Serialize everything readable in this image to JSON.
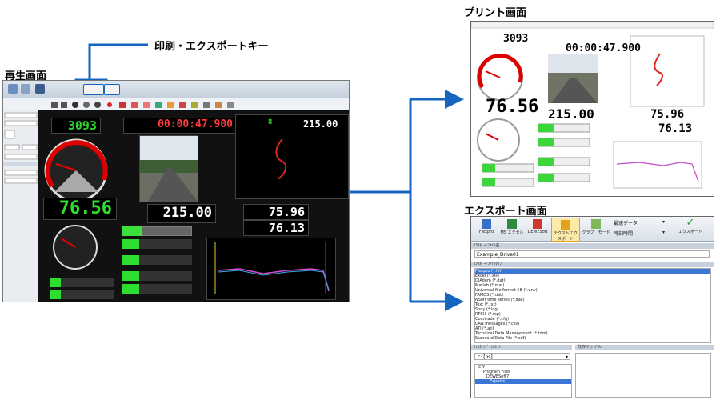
{
  "labels": {
    "playback_screen": "再生画面",
    "print_export_key": "印刷・エクスポートキー",
    "print_screen": "プリント画面",
    "export_screen": "エクスポート画面"
  },
  "playback": {
    "counter": "3093",
    "timer": "00:00:47.900",
    "speed": "76.56",
    "distance": "215.00",
    "value_a": "75.96",
    "value_b": "76.13",
    "small_left": "8",
    "small_right": "215.00"
  },
  "print": {
    "counter": "3093",
    "timer": "00:00:47.900",
    "speed": "76.56",
    "distance": "215.00",
    "value_a": "75.96",
    "value_b": "76.13"
  },
  "export": {
    "ribbon": [
      {
        "label": "Flexpro",
        "color": "#3a6fc7"
      },
      {
        "label": "MS エクセル",
        "color": "#2e8b3d"
      },
      {
        "label": "DEWESoft",
        "color": "#d2372c"
      },
      {
        "label": "テクストエクスポート",
        "color": "#e4a11b"
      },
      {
        "label": "グラフ゛モード",
        "color": "#7fb85a"
      }
    ],
    "dropdown1": "最速データ",
    "dropdown2": "時刻時間",
    "export_button": "エクスポート",
    "file_name_header": "ｴｸｽﾎﾟｰﾄﾌｧｲﾙ名",
    "file_name": "Example_Drive01",
    "file_type_header": "ｴｸｽﾎﾟｰﾄﾌｧｲﾙﾀｲﾌﾟ",
    "formats": [
      "Flexpro (*.fxf)",
      "Excel (*.xls)",
      "DIAdem (*.dat)",
      "Matlab (*.mat)",
      "Universal file format 58 (*.unv)",
      "FAMOS (*.dat)",
      "NSoft time series (*.dac)",
      "Text (*.txt)",
      "Sony (*.log)",
      "RPCIII (*.rsp)",
      "Comtrade (*.cfg)",
      "CAN messages (*.csv)",
      "ATI (*.ati)",
      "Technical Data Management (*.tdm)",
      "Standard Data File (*.sdf)"
    ],
    "folder_header": "ﾌｫﾙﾀﾞ/ｼﾞｬﾝﾙｾｯﾄ",
    "drive": "c: [os]",
    "folders": [
      "C:¥",
      "Program Files",
      "DEWESoft7",
      "Exports"
    ],
    "file_header": "既存ファイル"
  }
}
